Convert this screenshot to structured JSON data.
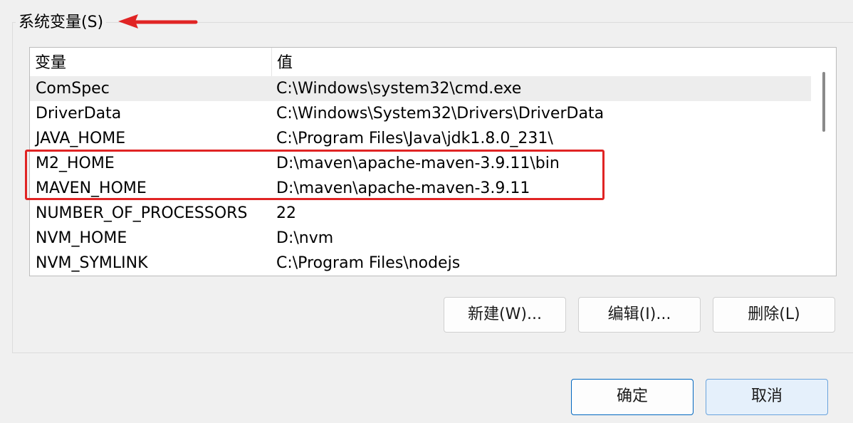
{
  "group": {
    "title": "系统变量(S)"
  },
  "table": {
    "columns": [
      "变量",
      "值"
    ],
    "rows": [
      {
        "name": "ComSpec",
        "value": "C:\\Windows\\system32\\cmd.exe"
      },
      {
        "name": "DriverData",
        "value": "C:\\Windows\\System32\\Drivers\\DriverData"
      },
      {
        "name": "JAVA_HOME",
        "value": "C:\\Program Files\\Java\\jdk1.8.0_231\\"
      },
      {
        "name": "M2_HOME",
        "value": "D:\\maven\\apache-maven-3.9.11\\bin"
      },
      {
        "name": "MAVEN_HOME",
        "value": "D:\\maven\\apache-maven-3.9.11"
      },
      {
        "name": "NUMBER_OF_PROCESSORS",
        "value": "22"
      },
      {
        "name": "NVM_HOME",
        "value": "D:\\nvm"
      },
      {
        "name": "NVM_SYMLINK",
        "value": "C:\\Program Files\\nodejs"
      }
    ]
  },
  "buttons": {
    "new": "新建(W)...",
    "edit": "编辑(I)...",
    "delete": "删除(L)",
    "ok": "确定",
    "cancel": "取消"
  },
  "colors": {
    "annotation": "#e02424",
    "accent": "#0067c0"
  },
  "icons": {
    "annotation_arrow": "left-arrow-icon"
  }
}
